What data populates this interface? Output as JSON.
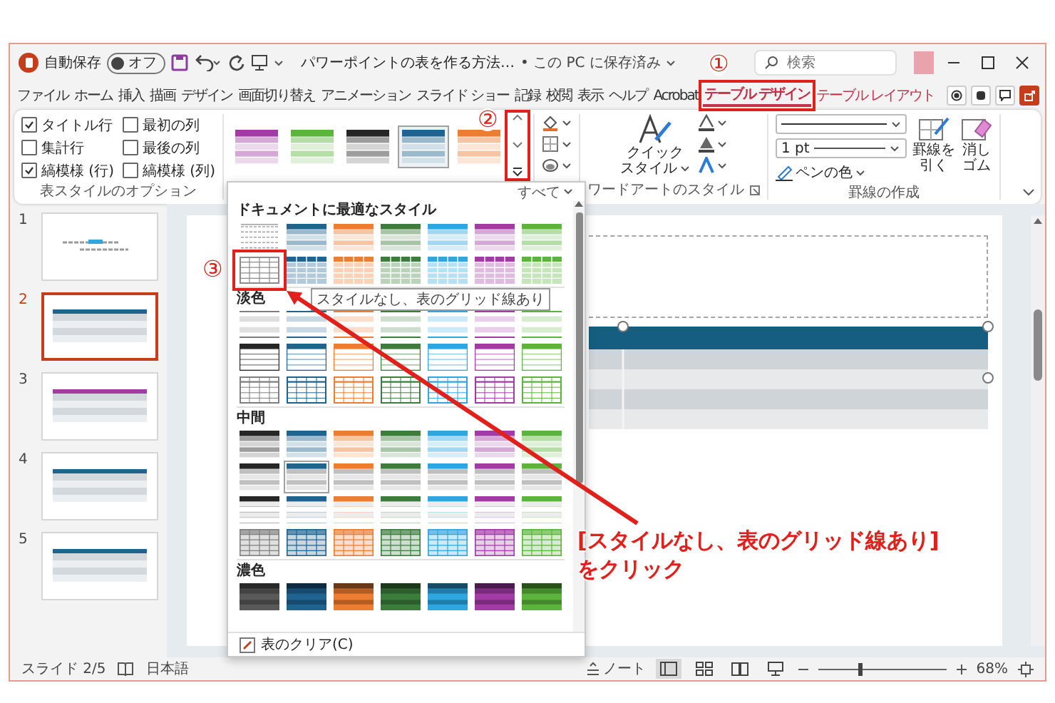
{
  "title_bar": {
    "autosave_label": "自動保存",
    "autosave": {
      "label": "オフ",
      "on": false
    },
    "title": "パワーポイントの表を作る方法…",
    "save_status": "• この PC に保存済み",
    "search": {
      "placeholder": "検索"
    }
  },
  "ribbon_tabs": [
    {
      "label": "ファイル",
      "kind": "normal",
      "selected": false
    },
    {
      "label": "ホーム",
      "kind": "normal",
      "selected": false
    },
    {
      "label": "挿入",
      "kind": "normal",
      "selected": false
    },
    {
      "label": "描画",
      "kind": "normal",
      "selected": false
    },
    {
      "label": "デザイン",
      "kind": "normal",
      "selected": false
    },
    {
      "label": "画面切り替え",
      "kind": "normal",
      "selected": false
    },
    {
      "label": "アニメーション",
      "kind": "normal",
      "selected": false
    },
    {
      "label": "スライド ショー",
      "kind": "normal",
      "selected": false
    },
    {
      "label": "記録",
      "kind": "normal",
      "selected": false
    },
    {
      "label": "校閲",
      "kind": "normal",
      "selected": false
    },
    {
      "label": "表示",
      "kind": "normal",
      "selected": false
    },
    {
      "label": "ヘルプ",
      "kind": "normal",
      "selected": false
    },
    {
      "label": "Acrobat",
      "kind": "normal",
      "selected": false
    },
    {
      "label": "テーブル デザイン",
      "kind": "contextual",
      "selected": true,
      "callout": "①"
    },
    {
      "label": "テーブル レイアウト",
      "kind": "contextual",
      "selected": false
    }
  ],
  "ribbon": {
    "table_style_options": {
      "options": [
        {
          "label": "タイトル行",
          "checked": true
        },
        {
          "label": "最初の列",
          "checked": false
        },
        {
          "label": "集計行",
          "checked": false
        },
        {
          "label": "最後の列",
          "checked": false
        },
        {
          "label": "縞模様 (行)",
          "checked": true
        },
        {
          "label": "縞模様 (列)",
          "checked": false
        }
      ],
      "group_label": "表スタイルのオプション"
    },
    "table_styles": {
      "items": [
        {
          "kind": "medium",
          "color": "#a23ba6",
          "selected": false
        },
        {
          "kind": "medium",
          "color": "#5bb53c",
          "selected": false
        },
        {
          "kind": "medium",
          "color": "#262626",
          "selected": false
        },
        {
          "kind": "medium",
          "color": "#1f6391",
          "selected": true
        },
        {
          "kind": "medium",
          "color": "#ed7d31",
          "selected": false
        }
      ],
      "more_callout": "②"
    },
    "wordart": {
      "quick_style": [
        "クイック",
        "スタイル"
      ],
      "group_label": "ワードアートのスタイル"
    },
    "draw_borders": {
      "pen_weight": "1 pt",
      "pen_color": "ペンの色",
      "draw_table": [
        "罫線を",
        "引く"
      ],
      "eraser": [
        "消し",
        "ゴム"
      ],
      "group_label": "罫線の作成"
    }
  },
  "slides": [
    {
      "number": "1",
      "kind": "title",
      "selected": false
    },
    {
      "number": "2",
      "kind": "table",
      "color": "#1f6391",
      "selected": true
    },
    {
      "number": "3",
      "kind": "table",
      "color": "#a23ba6",
      "selected": false
    },
    {
      "number": "4",
      "kind": "table",
      "color": "#1f6391",
      "selected": false
    },
    {
      "number": "5",
      "kind": "table",
      "color": "#1f6391",
      "selected": false
    }
  ],
  "style_gallery": {
    "show_all": "すべて",
    "sections": [
      {
        "title": "ドキュメントに最適なスタイル",
        "rows": [
          {
            "items": [
              {
                "kind": "none",
                "color": "#a6a6a6",
                "selected": false
              },
              {
                "kind": "medium",
                "color": "#1f6391",
                "selected": false
              },
              {
                "kind": "medium",
                "color": "#ed7d31",
                "selected": false
              },
              {
                "kind": "medium",
                "color": "#3c7d3c",
                "selected": false
              },
              {
                "kind": "medium",
                "color": "#2ea6e0",
                "selected": false
              },
              {
                "kind": "medium",
                "color": "#a23ba6",
                "selected": false
              },
              {
                "kind": "medium",
                "color": "#5bb53c",
                "selected": false
              }
            ]
          },
          {
            "items": [
              {
                "kind": "grid",
                "color": "#8c8c8c",
                "selected": false,
                "callout": "③",
                "tooltip": "スタイルなし、表のグリッド線あり"
              },
              {
                "kind": "medium-grid",
                "color": "#1f6391",
                "selected": false
              },
              {
                "kind": "medium-grid",
                "color": "#ed7d31",
                "selected": false
              },
              {
                "kind": "medium-grid",
                "color": "#3c7d3c",
                "selected": false
              },
              {
                "kind": "medium-grid",
                "color": "#2ea6e0",
                "selected": false
              },
              {
                "kind": "medium-grid",
                "color": "#a23ba6",
                "selected": false
              },
              {
                "kind": "medium-grid",
                "color": "#5bb53c",
                "selected": false
              }
            ]
          }
        ]
      },
      {
        "title": "淡色",
        "rows": [
          {
            "items": [
              {
                "kind": "light",
                "color": "#7f7f7f",
                "selected": false
              },
              {
                "kind": "light",
                "color": "#1f6391",
                "selected": false
              },
              {
                "kind": "light",
                "color": "#ed7d31",
                "selected": false
              },
              {
                "kind": "light",
                "color": "#3c7d3c",
                "selected": false
              },
              {
                "kind": "light",
                "color": "#2ea6e0",
                "selected": false
              },
              {
                "kind": "light",
                "color": "#a23ba6",
                "selected": false
              },
              {
                "kind": "light",
                "color": "#5bb53c",
                "selected": false
              }
            ]
          },
          {
            "items": [
              {
                "kind": "light-header",
                "color": "#262626",
                "selected": false
              },
              {
                "kind": "light-header",
                "color": "#1f6391",
                "selected": false
              },
              {
                "kind": "light-header",
                "color": "#ed7d31",
                "selected": false
              },
              {
                "kind": "light-header",
                "color": "#3c7d3c",
                "selected": false
              },
              {
                "kind": "light-header",
                "color": "#2ea6e0",
                "selected": false
              },
              {
                "kind": "light-header",
                "color": "#a23ba6",
                "selected": false
              },
              {
                "kind": "light-header",
                "color": "#5bb53c",
                "selected": false
              }
            ]
          },
          {
            "items": [
              {
                "kind": "light-grid",
                "color": "#7f7f7f",
                "selected": false
              },
              {
                "kind": "light-grid",
                "color": "#1f6391",
                "selected": false
              },
              {
                "kind": "light-grid",
                "color": "#ed7d31",
                "selected": false
              },
              {
                "kind": "light-grid",
                "color": "#3c7d3c",
                "selected": false
              },
              {
                "kind": "light-grid",
                "color": "#2ea6e0",
                "selected": false
              },
              {
                "kind": "light-grid",
                "color": "#a23ba6",
                "selected": false
              },
              {
                "kind": "light-grid",
                "color": "#5bb53c",
                "selected": false
              }
            ]
          }
        ]
      },
      {
        "title": "中間",
        "rows": [
          {
            "items": [
              {
                "kind": "medium",
                "color": "#262626",
                "selected": false
              },
              {
                "kind": "medium",
                "color": "#1f6391",
                "selected": false
              },
              {
                "kind": "medium",
                "color": "#ed7d31",
                "selected": false
              },
              {
                "kind": "medium",
                "color": "#3c7d3c",
                "selected": false
              },
              {
                "kind": "medium",
                "color": "#2ea6e0",
                "selected": false
              },
              {
                "kind": "medium",
                "color": "#a23ba6",
                "selected": false
              },
              {
                "kind": "medium",
                "color": "#5bb53c",
                "selected": false
              }
            ]
          },
          {
            "items": [
              {
                "kind": "medium-banded",
                "color": "#262626",
                "selected": false
              },
              {
                "kind": "medium-banded",
                "color": "#1f6391",
                "selected": true
              },
              {
                "kind": "medium-banded",
                "color": "#ed7d31",
                "selected": false
              },
              {
                "kind": "medium-banded",
                "color": "#3c7d3c",
                "selected": false
              },
              {
                "kind": "medium-banded",
                "color": "#2ea6e0",
                "selected": false
              },
              {
                "kind": "medium-banded",
                "color": "#a23ba6",
                "selected": false
              },
              {
                "kind": "medium-banded",
                "color": "#5bb53c",
                "selected": false
              }
            ]
          },
          {
            "items": [
              {
                "kind": "medium-white",
                "color": "#262626",
                "selected": false
              },
              {
                "kind": "medium-white",
                "color": "#1f6391",
                "selected": false
              },
              {
                "kind": "medium-white",
                "color": "#ed7d31",
                "selected": false
              },
              {
                "kind": "medium-white",
                "color": "#3c7d3c",
                "selected": false
              },
              {
                "kind": "medium-white",
                "color": "#2ea6e0",
                "selected": false
              },
              {
                "kind": "medium-white",
                "color": "#a23ba6",
                "selected": false
              },
              {
                "kind": "medium-white",
                "color": "#5bb53c",
                "selected": false
              }
            ]
          },
          {
            "items": [
              {
                "kind": "tinted-grid",
                "color": "#7f7f7f",
                "selected": false
              },
              {
                "kind": "tinted-grid",
                "color": "#1f6391",
                "selected": false
              },
              {
                "kind": "tinted-grid",
                "color": "#ed7d31",
                "selected": false
              },
              {
                "kind": "tinted-grid",
                "color": "#3c7d3c",
                "selected": false
              },
              {
                "kind": "tinted-grid",
                "color": "#2ea6e0",
                "selected": false
              },
              {
                "kind": "tinted-grid",
                "color": "#a23ba6",
                "selected": false
              },
              {
                "kind": "tinted-grid",
                "color": "#5bb53c",
                "selected": false
              }
            ]
          }
        ]
      },
      {
        "title": "濃色",
        "rows": [
          {
            "items": [
              {
                "kind": "dark",
                "color": "#595959",
                "selected": false
              },
              {
                "kind": "dark",
                "color": "#1f6391",
                "selected": false
              },
              {
                "kind": "dark",
                "color": "#ed7d31",
                "selected": false
              },
              {
                "kind": "dark",
                "color": "#3c7d3c",
                "selected": false
              },
              {
                "kind": "dark",
                "color": "#2ea6e0",
                "selected": false
              },
              {
                "kind": "dark",
                "color": "#a23ba6",
                "selected": false
              },
              {
                "kind": "dark",
                "color": "#5bb53c",
                "selected": false
              }
            ]
          }
        ]
      }
    ],
    "clear": "表のクリア(C)"
  },
  "annotation": {
    "lines": [
      "[スタイルなし、表のグリッド線あり]",
      "をクリック"
    ]
  },
  "status_bar": {
    "slide": "スライド 2/5",
    "language": "日本語",
    "notes": "ノート",
    "views": [
      {
        "kind": "normal",
        "selected": true
      },
      {
        "kind": "sorter",
        "selected": false
      },
      {
        "kind": "reading",
        "selected": false
      },
      {
        "kind": "slideshow",
        "selected": false
      }
    ],
    "zoom": {
      "level": 0.33,
      "reading": "68%"
    }
  }
}
